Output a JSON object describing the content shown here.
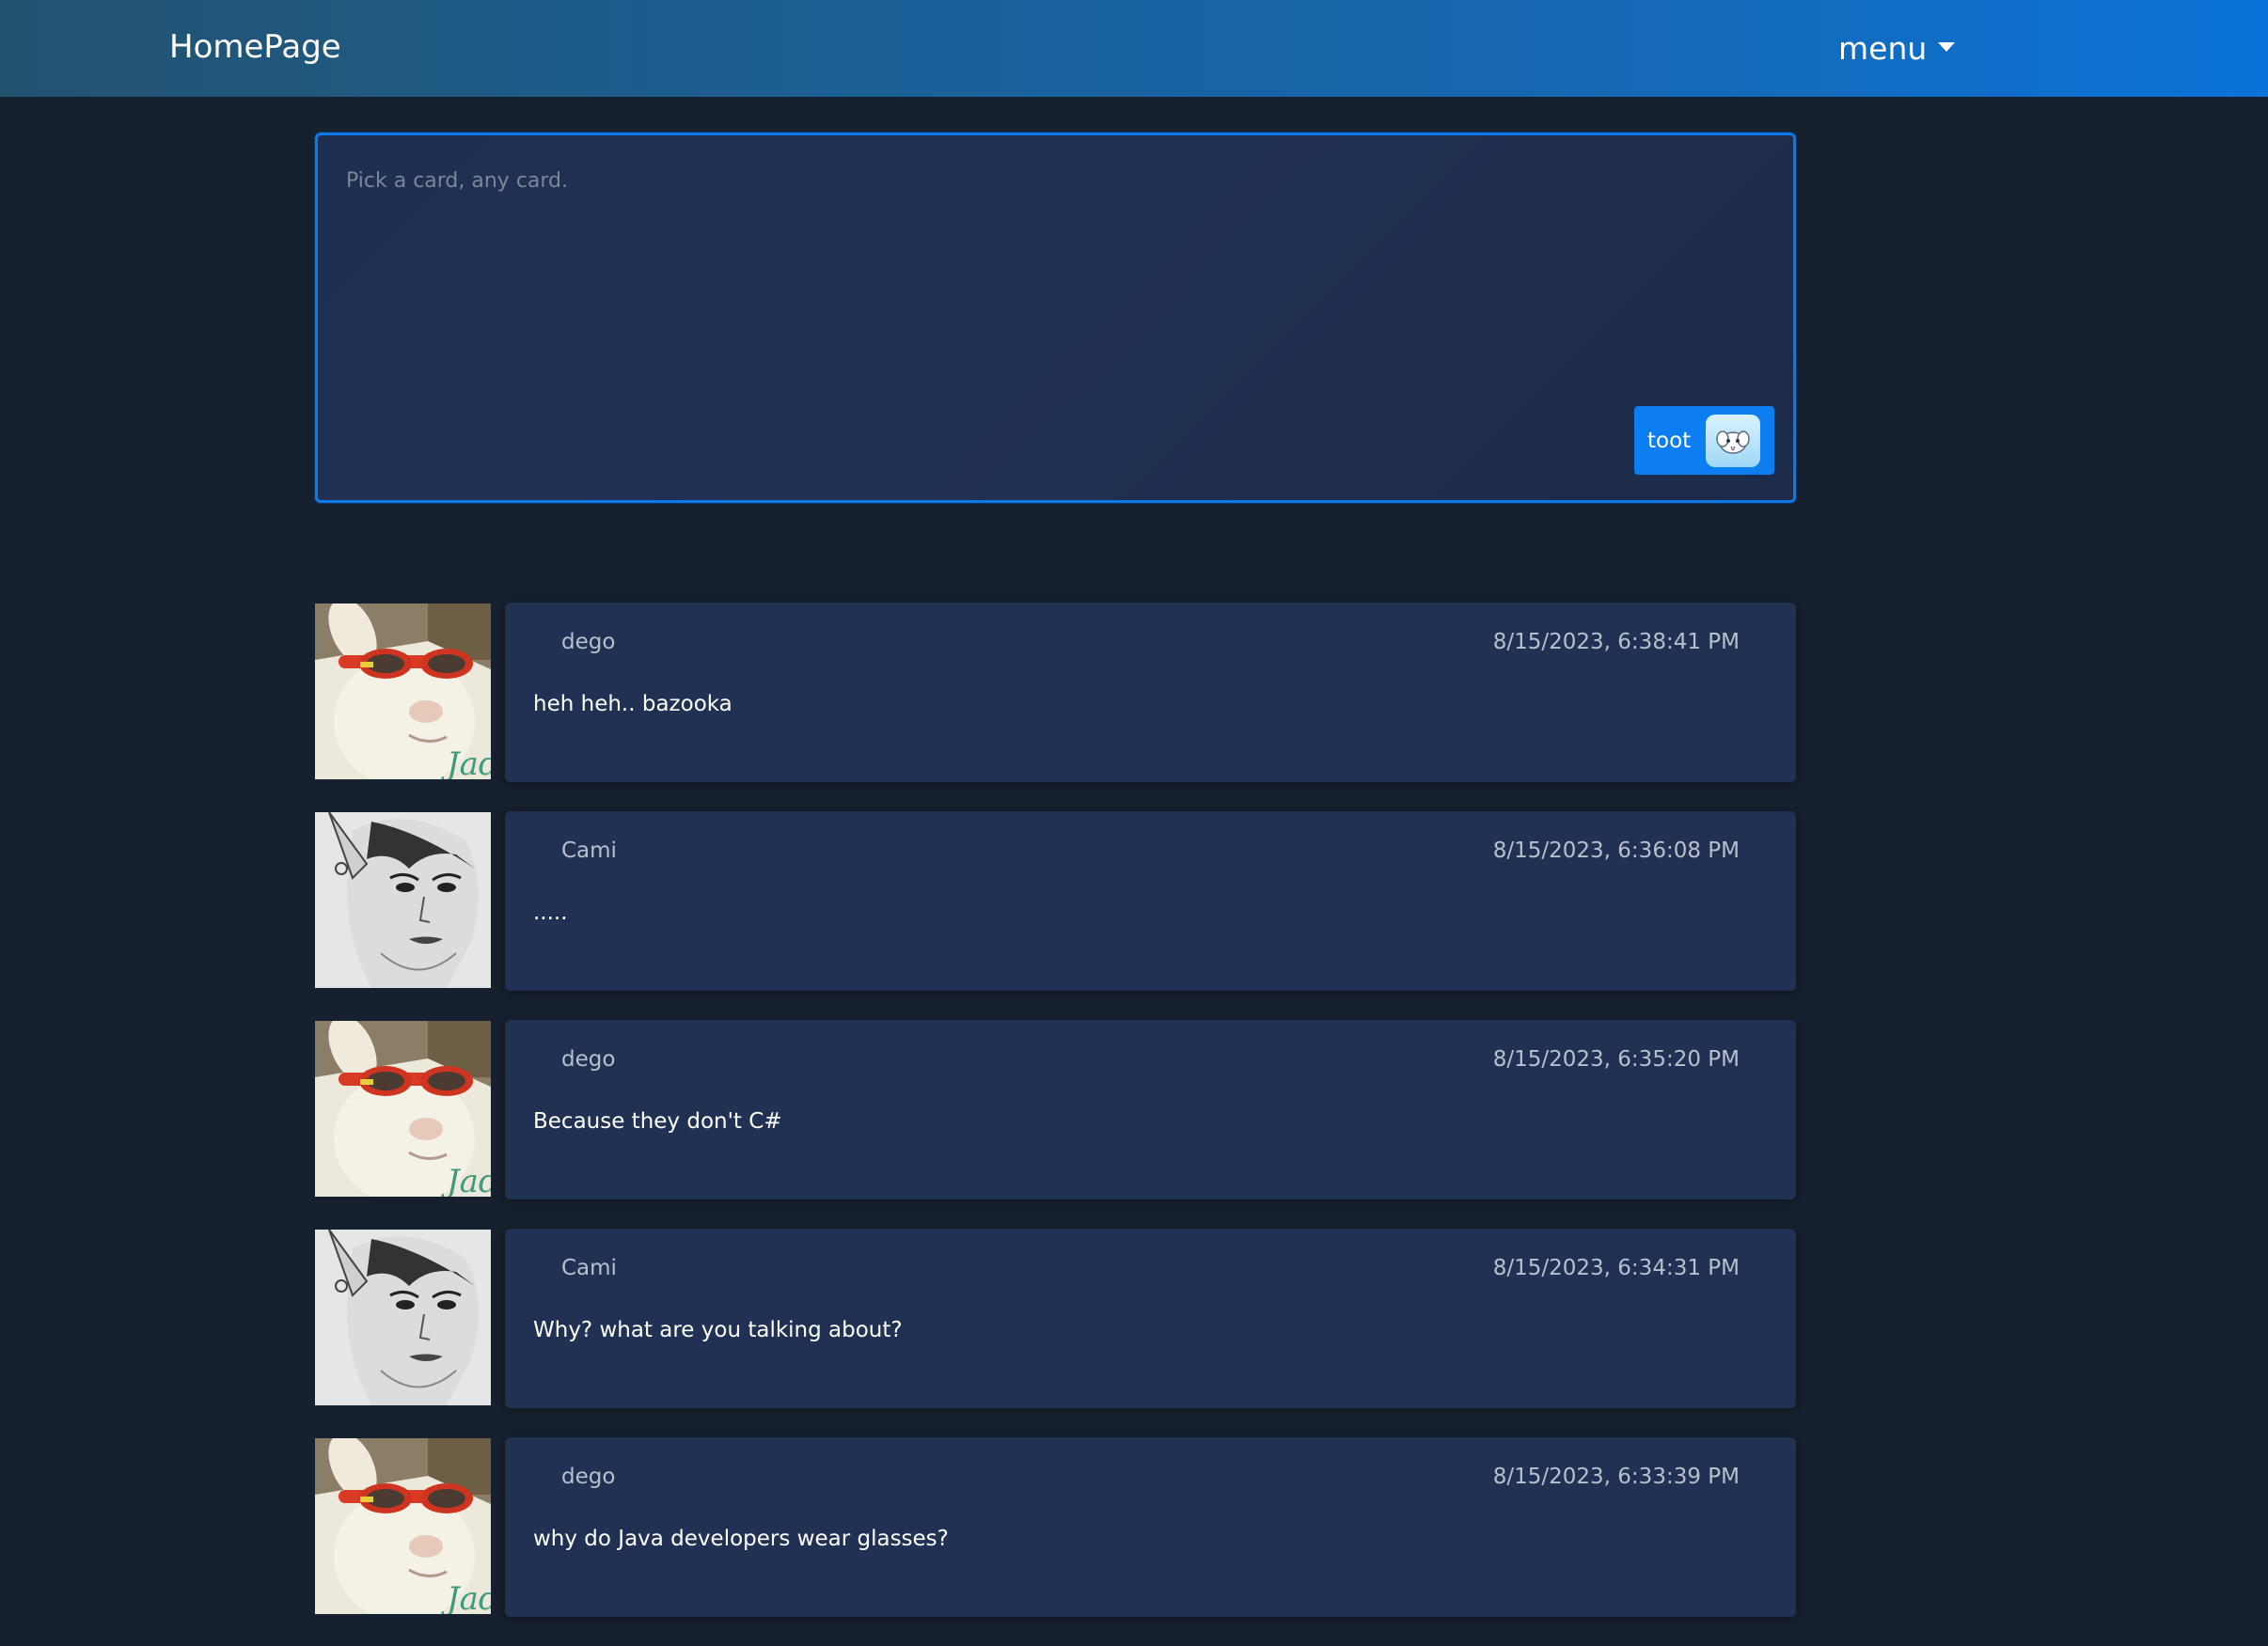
{
  "navbar": {
    "brand": "HomePage",
    "menu_label": "menu"
  },
  "composer": {
    "placeholder": "Pick a card, any card.",
    "value": "",
    "submit_label": "toot",
    "submit_icon": "elephant-icon"
  },
  "colors": {
    "background": "#17202e",
    "card": "#213153",
    "accent": "#0d7df2",
    "nav_start": "#23526f",
    "nav_end": "#0a72d8",
    "meta_text": "#b9bfcb"
  },
  "posts": [
    {
      "author": "dego",
      "timestamp": "8/15/2023, 6:38:41 PM",
      "text": "heh heh.. bazooka",
      "avatar": "goat-with-sunglasses"
    },
    {
      "author": "Cami",
      "timestamp": "8/15/2023, 6:36:08 PM",
      "text": ".....",
      "avatar": "elf-sketch"
    },
    {
      "author": "dego",
      "timestamp": "8/15/2023, 6:35:20 PM",
      "text": "Because they don't C#",
      "avatar": "goat-with-sunglasses"
    },
    {
      "author": "Cami",
      "timestamp": "8/15/2023, 6:34:31 PM",
      "text": "Why? what are you talking about?",
      "avatar": "elf-sketch"
    },
    {
      "author": "dego",
      "timestamp": "8/15/2023, 6:33:39 PM",
      "text": "why do Java developers wear glasses?",
      "avatar": "goat-with-sunglasses"
    }
  ]
}
